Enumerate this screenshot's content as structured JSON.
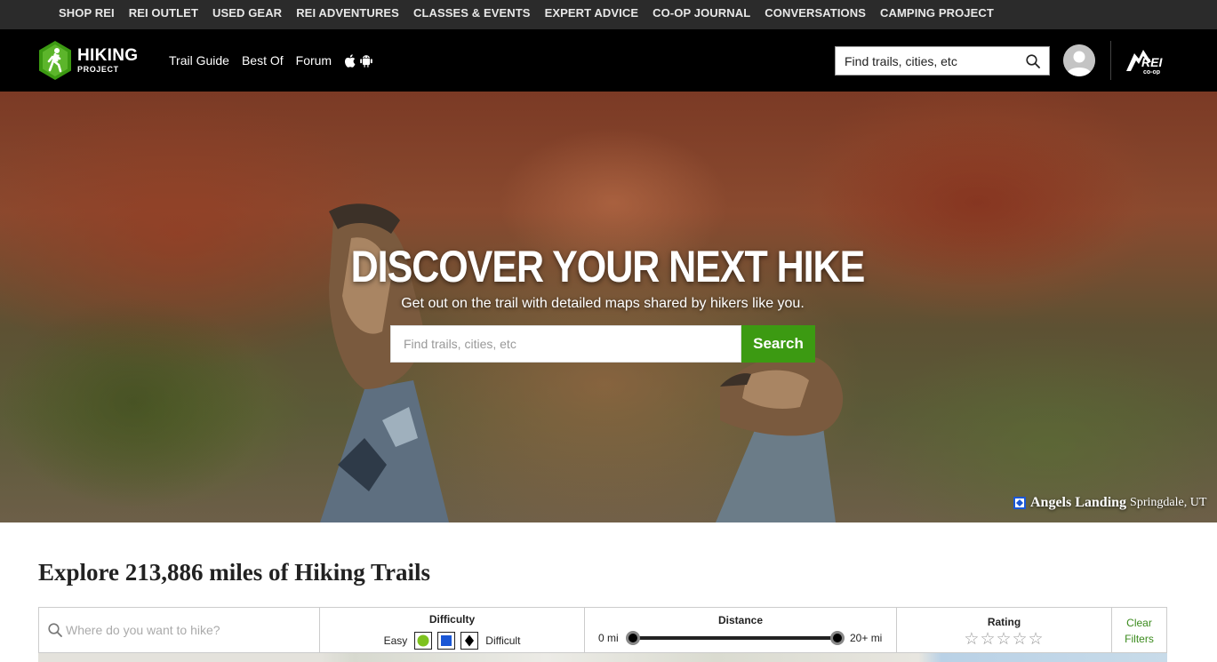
{
  "rei_nav": {
    "items": [
      "SHOP REI",
      "REI OUTLET",
      "USED GEAR",
      "REI ADVENTURES",
      "CLASSES & EVENTS",
      "EXPERT ADVICE",
      "CO-OP JOURNAL",
      "CONVERSATIONS",
      "CAMPING PROJECT"
    ]
  },
  "header": {
    "logo_line1": "HIKING",
    "logo_line2": "PROJECT",
    "nav": [
      "Trail Guide",
      "Best Of",
      "Forum"
    ],
    "app_icons": [
      "apple-icon",
      "android-icon"
    ],
    "search_placeholder": "Find trails, cities, etc",
    "partner_logo": "REI CO-OP"
  },
  "hero": {
    "title": "DISCOVER YOUR NEXT HIKE",
    "subtitle": "Get out on the trail with detailed maps shared by hikers like you.",
    "search_placeholder": "Find trails, cities, etc",
    "search_button": "Search",
    "photo_trail_name": "Angels Landing",
    "photo_location": "Springdale, UT"
  },
  "explore": {
    "title": "Explore 213,886 miles of Hiking Trails",
    "search_placeholder": "Where do you want to hike?",
    "difficulty": {
      "label": "Difficulty",
      "easy_label": "Easy",
      "difficult_label": "Difficult",
      "colors": {
        "easy": "#7dc21e",
        "intermediate": "#1a57d6",
        "difficult": "#000000"
      }
    },
    "distance": {
      "label": "Distance",
      "min_label": "0 mi",
      "max_label": "20+ mi",
      "range_fraction": [
        0.0,
        1.0
      ]
    },
    "rating": {
      "label": "Rating",
      "stars": "☆☆☆☆☆",
      "value": 0,
      "max": 5
    },
    "clear_filters": "Clear Filters"
  },
  "colors": {
    "accent_green": "#3c9a12",
    "rei_bar": "#2b2b2b",
    "header_bg": "#000000"
  }
}
